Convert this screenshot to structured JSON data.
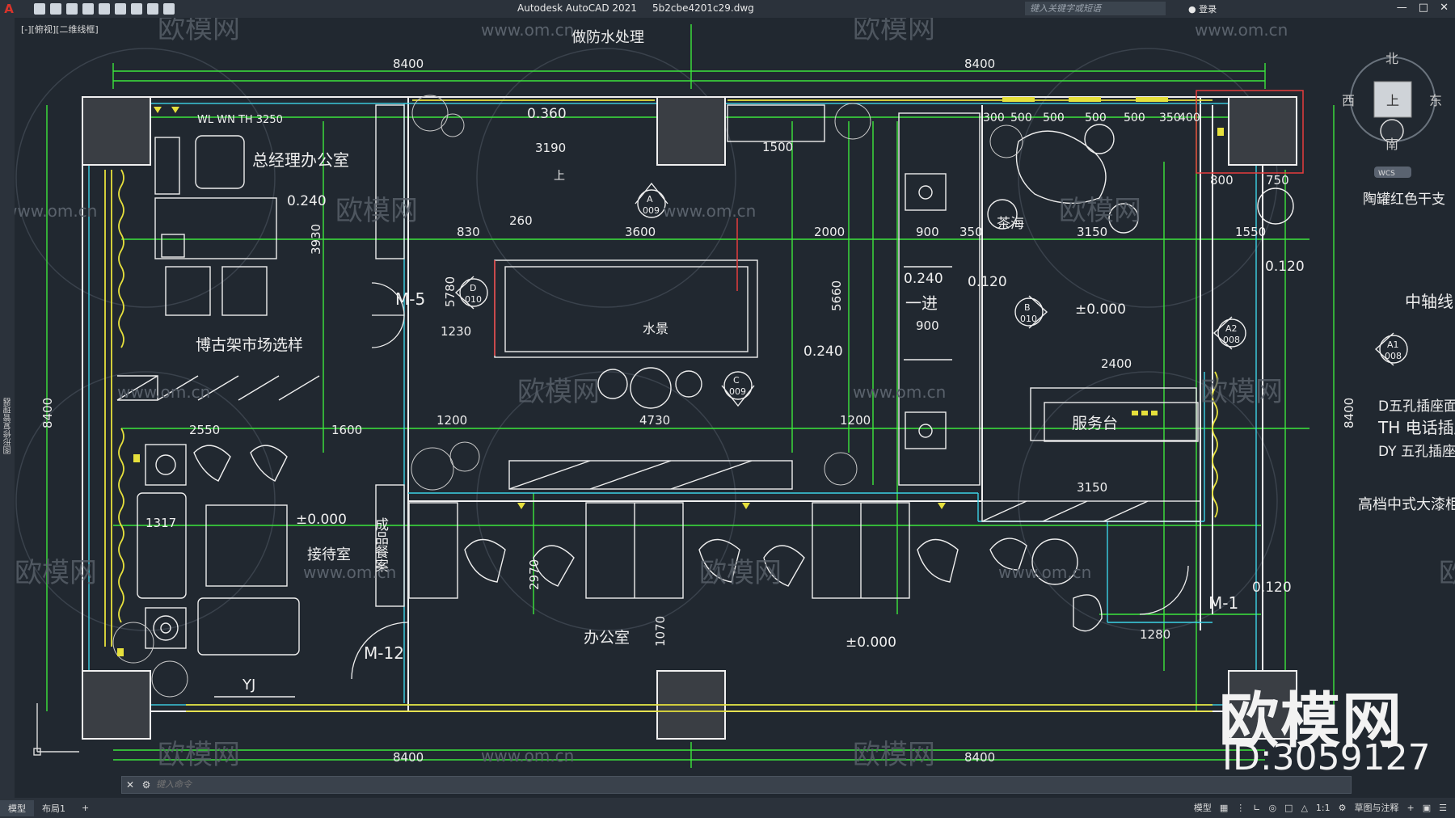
{
  "titlebar": {
    "app_title": "Autodesk AutoCAD 2021",
    "file_name": "5b2cbe4201c29.dwg",
    "search_placeholder": "键入关键字或短语",
    "login_label": "登录"
  },
  "viewport": {
    "view_label": "[-][俯视][二维线框]",
    "left_panel_label": "图形修复管理器"
  },
  "compass": {
    "north": "北",
    "south": "南",
    "east": "东",
    "west": "西",
    "top": "上",
    "wcs": "WCS"
  },
  "rooms": {
    "gm_office": "总经理办公室",
    "shelf": "博古架市场选样",
    "reception": "接待室",
    "office": "办公室",
    "water_feature": "水景",
    "tea_sea": "茶海",
    "service_desk": "服务台",
    "entrance": "一进",
    "finished_cabinet": "成品餐案",
    "waterproof": "做防水处理",
    "upstairs": "上"
  },
  "annotations": {
    "wl_wn": "WL WN TH 3250",
    "m5": "M-5",
    "m12": "M-12",
    "m1": "M-1",
    "yj": "YJ",
    "axis": "中轴线",
    "pottery": "陶罐红色干支",
    "d_socket": "D五孔插座面",
    "th_phone": "TH 电话插座",
    "dy_socket": "DY 五孔插座",
    "lacquer": "高档中式大漆柜"
  },
  "dimensions": {
    "top_left_8400": "8400",
    "top_right_8400": "8400",
    "bottom_left_8400": "8400",
    "bottom_right_8400": "8400",
    "left_8400": "8400",
    "right_8400": "8400",
    "d3190": "3190",
    "d3600": "3600",
    "d2000": "2000",
    "d3150a": "3150",
    "d3150b": "3150",
    "d1550": "1550",
    "d4730": "4730",
    "d2550": "2550",
    "d1600": "1600",
    "d1200a": "1200",
    "d1200b": "1200",
    "d2400": "2400",
    "d1230": "1230",
    "d830": "830",
    "d260": "260",
    "d1500": "1500",
    "d900a": "900",
    "d900b": "900",
    "d350": "350",
    "d1317": "1317",
    "d1280": "1280",
    "d800": "800",
    "d750": "750",
    "d2970": "2970",
    "d1070": "1070",
    "d5660": "5660",
    "d3930": "3930",
    "d5780": "5780",
    "row500": [
      "300",
      "500",
      "500",
      "500",
      "500",
      "350",
      "400"
    ]
  },
  "levels": {
    "l0360": "0.360",
    "l0240a": "0.240",
    "l0240b": "0.240",
    "l0240c": "0.240",
    "l0120a": "0.120",
    "l0120b": "0.120",
    "l0120c": "0.120",
    "l0000a": "±0.000",
    "l0000b": "±0.000",
    "l0000c": "±0.000"
  },
  "markers": {
    "a": [
      "A",
      "009"
    ],
    "b": [
      "B",
      "010"
    ],
    "c": [
      "C",
      "009"
    ],
    "d": [
      "D",
      "010"
    ],
    "a1": [
      "A1",
      "008"
    ],
    "a2": [
      "A2",
      "008"
    ]
  },
  "watermark": {
    "site": "www.om.cn",
    "brand": "欧模网",
    "id": "ID:3059127"
  },
  "command": {
    "placeholder": "键入命令"
  },
  "status": {
    "tab_model": "模型",
    "tab_layout": "布局1",
    "add_tab": "+",
    "model_label": "模型",
    "scale": "1:1",
    "workspace": "草图与注释"
  },
  "colors": {
    "background": "#212830",
    "wall": "#f0f0f0",
    "dim_green": "#3ce63c",
    "yellow": "#e6e03c",
    "cyan": "#3cd2e6",
    "red": "#e63c3c",
    "white_text": "#eeeeee"
  }
}
